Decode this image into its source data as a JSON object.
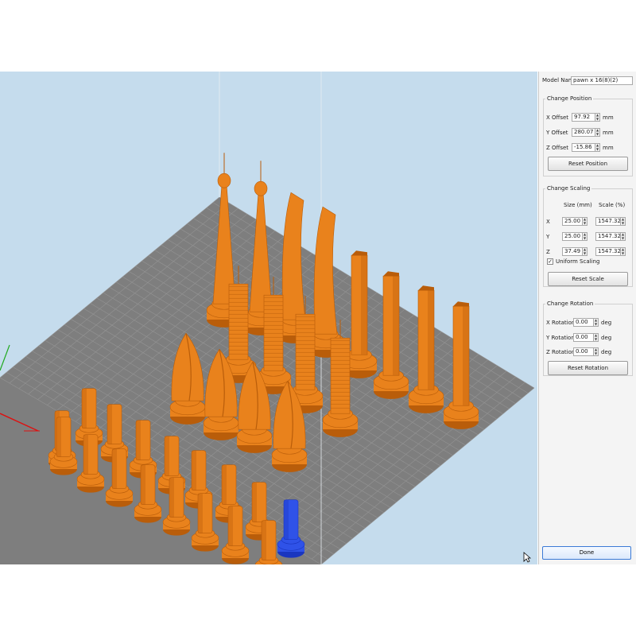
{
  "panel": {
    "model_name_label": "Model Name:",
    "model_name_value": "pawn x 16(8)(2)",
    "position": {
      "title": "Change Position",
      "x_label": "X Offset",
      "x_value": "97.92",
      "x_unit": "mm",
      "y_label": "Y Offset",
      "y_value": "280.07",
      "y_unit": "mm",
      "z_label": "Z Offset",
      "z_value": "-15.86",
      "z_unit": "mm",
      "reset_label": "Reset Position"
    },
    "scaling": {
      "title": "Change Scaling",
      "size_header": "Size (mm)",
      "scale_header": "Scale (%)",
      "rows": [
        {
          "axis": "X",
          "size": "25.00",
          "scale": "1547.32"
        },
        {
          "axis": "Y",
          "size": "25.00",
          "scale": "1547.32"
        },
        {
          "axis": "Z",
          "size": "37.49",
          "scale": "1547.32"
        }
      ],
      "uniform_label": "Uniform Scaling",
      "uniform_checked": true,
      "reset_label": "Reset Scale"
    },
    "rotation": {
      "title": "Change Rotation",
      "x_label": "X Rotation",
      "x_value": "0.00",
      "x_unit": "deg",
      "y_label": "Y Rotation",
      "y_value": "0.00",
      "y_unit": "deg",
      "z_label": "Z Rotation",
      "z_value": "0.00",
      "z_unit": "deg",
      "reset_label": "Reset Rotation"
    },
    "done_label": "Done"
  },
  "colors": {
    "background": "#c5dced",
    "bed": "#7e7e7e",
    "grid": "#9a9a9a",
    "model": "#e9821c",
    "model_dark": "#b95d0a",
    "selected": "#2f52e8",
    "selected_dark": "#1a36c0"
  }
}
